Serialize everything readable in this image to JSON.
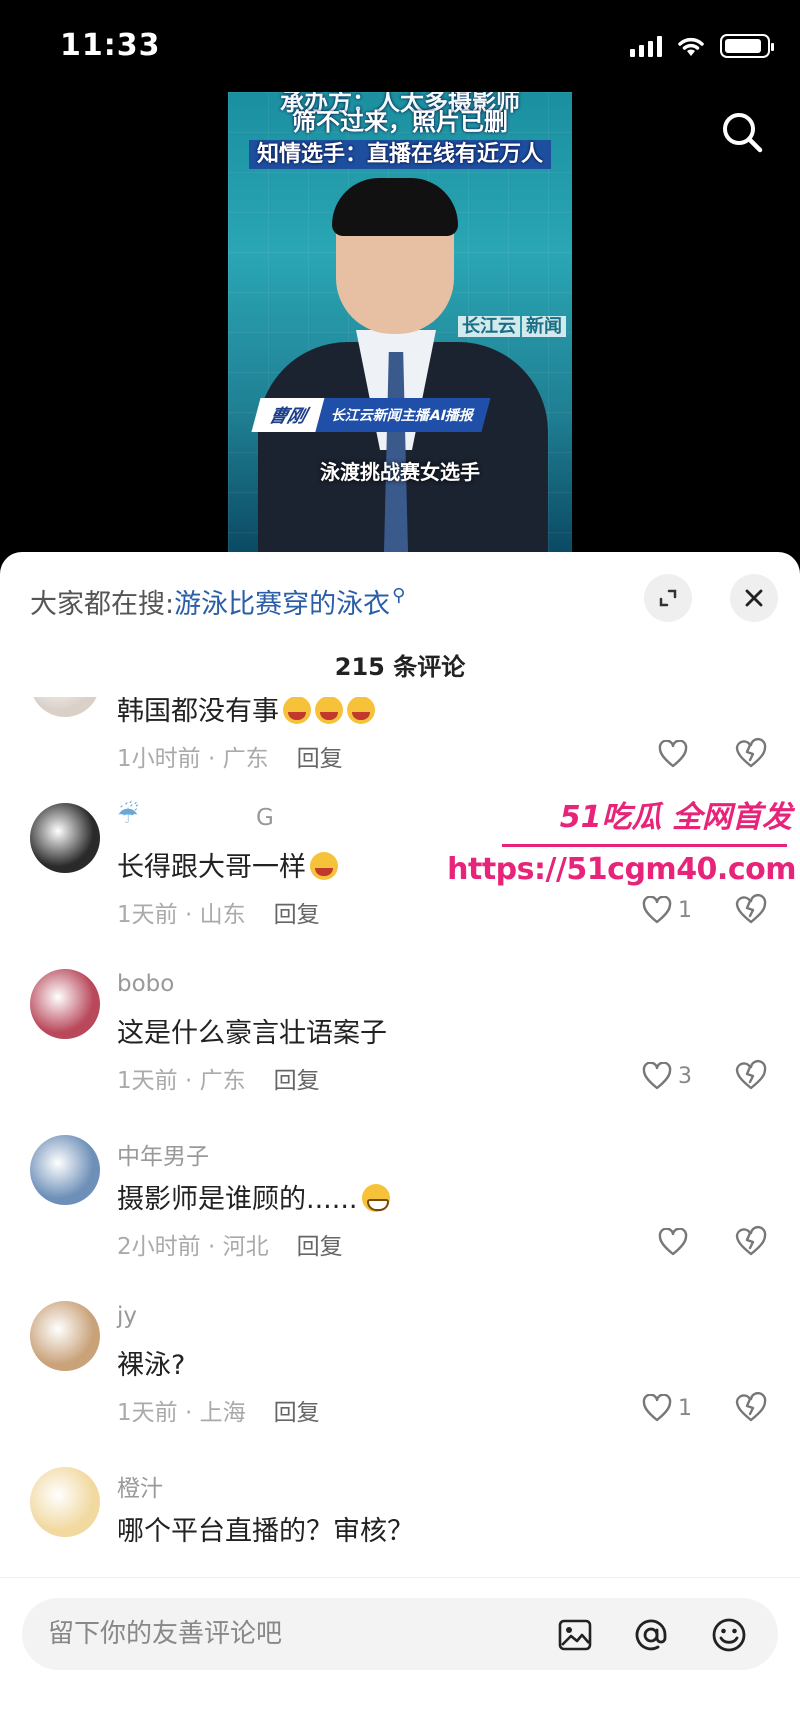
{
  "status_bar": {
    "time": "11:33"
  },
  "video": {
    "caption_cut": "承办方：人太多摄影师",
    "caption_line2": "筛不过来，照片已删",
    "caption_line3": "知情选手：直播在线有近万人",
    "channel_logo": "长江云",
    "channel_logo_tag": "新闻",
    "anchor_name": "曹刚",
    "anchor_role": "长江云新闻主播AI播报",
    "subtitle": "泳渡挑战赛女选手"
  },
  "sheet": {
    "hot_search_prefix": "大家都在搜:",
    "hot_search_term": "游泳比赛穿的泳衣",
    "comment_count": "215 条评论"
  },
  "comments": [
    {
      "user": "",
      "text": "韩国都没有事",
      "emoji": [
        "cry",
        "cry",
        "cry"
      ],
      "time": "1小时前 · 广东",
      "reply": "回复",
      "likes": "",
      "avatar_color": "#d9d0c8"
    },
    {
      "user": "G",
      "text": "长得跟大哥一样",
      "emoji": [
        "cry"
      ],
      "time": "1天前 · 山东",
      "reply": "回复",
      "likes": "1",
      "avatar_color": "#2a2a2a"
    },
    {
      "user": "bobo",
      "text": "这是什么豪言壮语案子",
      "emoji": [],
      "time": "1天前 · 广东",
      "reply": "回复",
      "likes": "3",
      "avatar_color": "#b8485a"
    },
    {
      "user": "中年男子",
      "text": "摄影师是谁顾的......",
      "emoji": [
        "grin"
      ],
      "time": "2小时前 · 河北",
      "reply": "回复",
      "likes": "",
      "avatar_color": "#6d8fb8"
    },
    {
      "user": "jy",
      "text": "裸泳?",
      "emoji": [],
      "time": "1天前 · 上海",
      "reply": "回复",
      "likes": "1",
      "avatar_color": "#c9a27a"
    },
    {
      "user": "橙汁",
      "text": "哪个平台直播的？审核？",
      "emoji": [],
      "time": "",
      "reply": "",
      "likes": "",
      "avatar_color": "#f1d9a0"
    }
  ],
  "watermark": {
    "brand": "51吃瓜 全网首发",
    "url": "https://51cgm40.com"
  },
  "input": {
    "placeholder": "留下你的友善评论吧"
  }
}
